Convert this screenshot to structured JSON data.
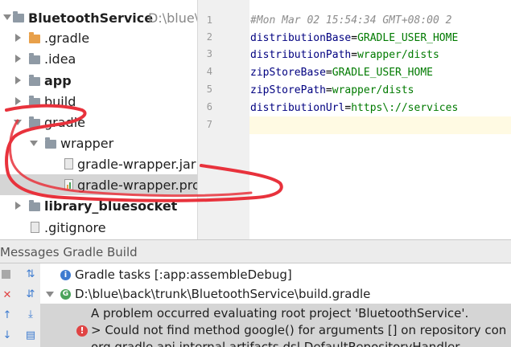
{
  "tree": {
    "root_name": "BluetoothService",
    "root_path": "D:\\blue\\",
    "items": [
      {
        "label": ".gradle"
      },
      {
        "label": ".idea"
      },
      {
        "label": "app"
      },
      {
        "label": "build"
      },
      {
        "label": "gradle"
      },
      {
        "label": "wrapper"
      },
      {
        "label": "gradle-wrapper.jar"
      },
      {
        "label": "gradle-wrapper.prop"
      },
      {
        "label": "library_bluesocket"
      },
      {
        "label": ".gitignore"
      }
    ]
  },
  "editor": {
    "line_numbers": [
      "1",
      "2",
      "3",
      "4",
      "5",
      "6",
      "7"
    ],
    "comment_line": "#Mon Mar 02 15:54:34 GMT+08:00 2",
    "props": [
      {
        "key": "distributionBase",
        "value": "GRADLE_USER_HOME"
      },
      {
        "key": "distributionPath",
        "value": "wrapper/dists"
      },
      {
        "key": "zipStoreBase",
        "value": "GRADLE_USER_HOME"
      },
      {
        "key": "zipStorePath",
        "value": "wrapper/dists"
      },
      {
        "key": "distributionUrl",
        "value": "https\\://services"
      }
    ]
  },
  "panel": {
    "title": "Messages Gradle Build",
    "rows": [
      {
        "text": "Gradle tasks [:app:assembleDebug]"
      },
      {
        "text": "D:\\blue\\back\\trunk\\BluetoothService\\build.gradle"
      },
      {
        "text": "A problem occurred evaluating root project 'BluetoothService'."
      },
      {
        "text": "> Could not find method google() for arguments [] on repository con"
      },
      {
        "text": "org.gradle.api.internal.artifacts.dsl.DefaultRepositoryHandler"
      }
    ]
  },
  "colors": {
    "annotation_red": "#e8323c",
    "folder_orange": "#e8a04a",
    "folder_gray": "#8f9aa5",
    "folder_blue": "#6fa1d6",
    "selection_gray": "#d5d5d5"
  }
}
